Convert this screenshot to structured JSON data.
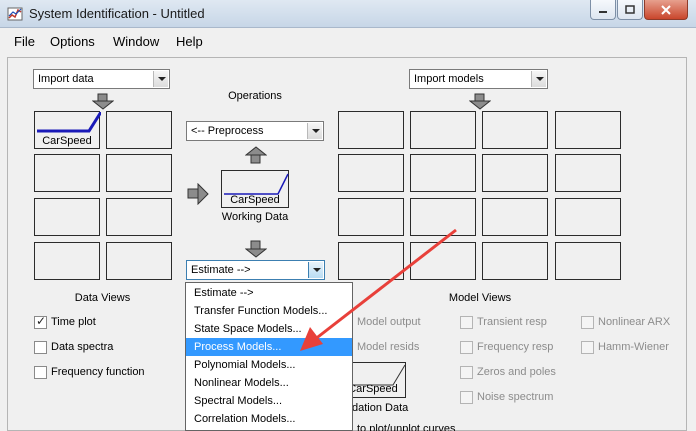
{
  "window": {
    "title": "System Identification - Untitled",
    "controls": [
      "minimize",
      "maximize",
      "close"
    ]
  },
  "menu": [
    "File",
    "Options",
    "Window",
    "Help"
  ],
  "import_data": {
    "selected": "Import data"
  },
  "import_models": {
    "selected": "Import models"
  },
  "data_board": {
    "slot_label": "CarSpeed",
    "title": "Data Views"
  },
  "operations": {
    "title": "Operations",
    "preprocess": "<-- Preprocess",
    "working_data_slot": "CarSpeed",
    "working_data_caption": "Working Data",
    "estimate": "Estimate -->",
    "validation_slot": "CarSpeed",
    "validation_caption": "dation Data",
    "hint_partial": "to plot/unplot curves"
  },
  "estimate_dropdown": {
    "items": [
      "Estimate -->",
      "Transfer Function Models...",
      "State Space Models...",
      "Process Models...",
      "Polynomial Models...",
      "Nonlinear Models...",
      "Spectral Models...",
      "Correlation Models..."
    ],
    "selected": "Process Models..."
  },
  "data_views": {
    "title": "Data Views",
    "options": [
      {
        "label": "Time plot",
        "checked": true
      },
      {
        "label": "Data spectra",
        "checked": false
      },
      {
        "label": "Frequency function",
        "checked": false
      }
    ]
  },
  "model_views": {
    "title": "Model Views",
    "partial_options": [
      "Model output",
      "Model resids"
    ],
    "options_col2": [
      "Transient resp",
      "Frequency resp",
      "Zeros and poles",
      "Noise spectrum"
    ],
    "options_col3": [
      "Nonlinear ARX",
      "Hamm-Wiener"
    ]
  },
  "colors": {
    "annotation_arrow": "#e8403a",
    "signal_line": "#1a1ab8",
    "selection": "#3399ff"
  }
}
